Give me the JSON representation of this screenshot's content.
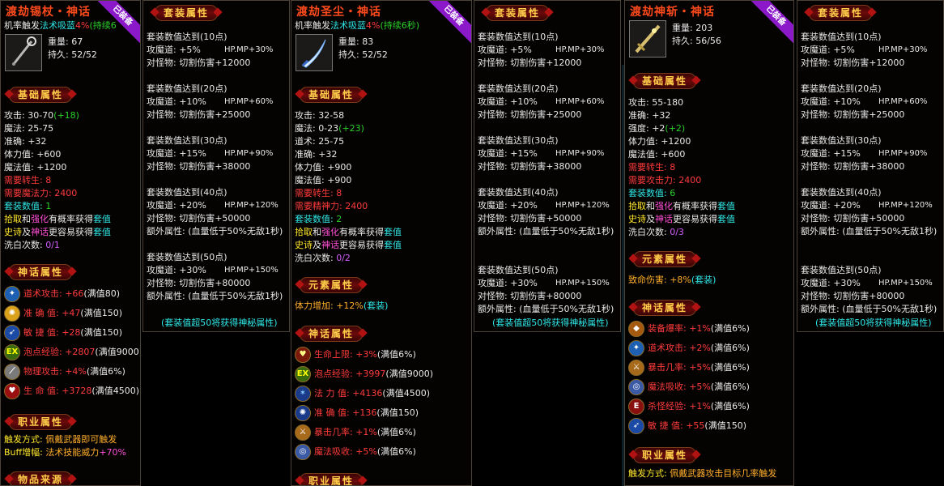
{
  "colors": {
    "title": "#ff4a1c",
    "ribbon": "#8b19c9",
    "cyan": "#2ee6e6",
    "green": "#2bd02b",
    "red": "#ff3b3b",
    "badge_text": "#ffcf4a"
  },
  "items": [
    {
      "title": "渡劫锡杖・神话",
      "equipped": "已装备",
      "trigger": "机率触发",
      "trigger_skill": "法术吸蓝",
      "trigger_pct": "4%",
      "trigger_dur": "(持续6",
      "weight_label": "重量:",
      "weight": "67",
      "dura_label": "持久:",
      "dura": "52/52",
      "icon": "staff-icon",
      "base_title": "基础属性",
      "base": [
        {
          "k": "攻击: ",
          "v": "30-70",
          "extra": "(+18)"
        },
        {
          "k": "魔法: ",
          "v": "25-75",
          "extra": ""
        },
        {
          "k": "准确: ",
          "v": "+32",
          "extra": ""
        },
        {
          "k": "体力值: ",
          "v": "+600",
          "extra": ""
        },
        {
          "k": "魔法值: ",
          "v": "+1200",
          "extra": ""
        }
      ],
      "req": [
        {
          "k": "需要转生: ",
          "v": "8"
        },
        {
          "k": "需要魔法力: ",
          "v": "2400"
        }
      ],
      "set_count_label": "套装数值: ",
      "set_count": "1",
      "tips1": [
        "拾取",
        "和",
        "强化",
        "有概率获得",
        "套值"
      ],
      "tips2": [
        "史诗",
        "及",
        "神话",
        "更容易获得",
        "套值"
      ],
      "wash_label": "洗白次数: ",
      "wash": "0/1",
      "myth_title": "神话属性",
      "myth": [
        {
          "icon": "tao-attack-icon",
          "k": "道术攻击: ",
          "v": "+66",
          "max": "(满值80)"
        },
        {
          "icon": "accuracy-icon",
          "k": "准 确 值: ",
          "v": "+47",
          "max": "(满值150)"
        },
        {
          "icon": "agility-icon",
          "k": "敏 捷 值: ",
          "v": "+28",
          "max": "(满值150)"
        },
        {
          "icon": "exp-orb-icon",
          "k": "泡点经验: ",
          "v": "+2807",
          "max": "(满值9000)"
        },
        {
          "icon": "physical-attack-icon",
          "k": "物理攻击: ",
          "v": "+4%",
          "max": "(满值6%)"
        },
        {
          "icon": "life-icon",
          "k": "生 命 值: ",
          "v": "+3728",
          "max": "(满值4500)"
        }
      ],
      "job_title": "职业属性",
      "job": [
        {
          "k": "触发方式: ",
          "v": "佩戴武器即可触发"
        },
        {
          "k": "Buff增幅: ",
          "v": "法术技能威力",
          "extra": "+70%"
        }
      ],
      "source_title": "物品来源"
    },
    {
      "title": "渡劫圣尘・神话",
      "equipped": "已装备",
      "trigger": "机率触发",
      "trigger_skill": "法术吸蓝",
      "trigger_pct": "4%",
      "trigger_dur": "(持续6秒)",
      "weight_label": "重量:",
      "weight": "83",
      "dura_label": "持久:",
      "dura": "52/52",
      "icon": "blade-icon",
      "base_title": "基础属性",
      "base": [
        {
          "k": "攻击: ",
          "v": "32-58",
          "extra": ""
        },
        {
          "k": "魔法: ",
          "v": "0-23",
          "extra": "(+23)"
        },
        {
          "k": "道术: ",
          "v": "25-75",
          "extra": ""
        },
        {
          "k": "准确: ",
          "v": "+32",
          "extra": ""
        },
        {
          "k": "体力值: ",
          "v": "+900",
          "extra": ""
        },
        {
          "k": "魔法值: ",
          "v": "+900",
          "extra": ""
        }
      ],
      "req": [
        {
          "k": "需要转生: ",
          "v": "8"
        },
        {
          "k": "需要精神力: ",
          "v": "2400"
        }
      ],
      "set_count_label": "套装数值: ",
      "set_count": "2",
      "tips1": [
        "拾取",
        "和",
        "强化",
        "有概率获得",
        "套值"
      ],
      "tips2": [
        "史诗",
        "及",
        "神话",
        "更容易获得",
        "套值"
      ],
      "wash_label": "洗白次数: ",
      "wash": "0/2",
      "element_title": "元素属性",
      "element": {
        "k": "体力增加: ",
        "v": "+12%",
        "extra": "(套装)"
      },
      "myth_title": "神话属性",
      "myth": [
        {
          "icon": "heart-icon",
          "k": "生命上限: ",
          "v": "+3%",
          "max": "(满值6%)"
        },
        {
          "icon": "exp-orb-icon",
          "k": "泡点经验: ",
          "v": "+3997",
          "max": "(满值9000)"
        },
        {
          "icon": "magic-power-icon",
          "k": "法 力 值: ",
          "v": "+4136",
          "max": "(满值4500)"
        },
        {
          "icon": "accuracy-icon",
          "k": "准 确 值: ",
          "v": "+136",
          "max": "(满值150)"
        },
        {
          "icon": "crit-icon",
          "k": "暴击几率: ",
          "v": "+1%",
          "max": "(满值6%)"
        },
        {
          "icon": "mana-drain-icon",
          "k": "魔法吸收: ",
          "v": "+5%",
          "max": "(满值6%)"
        }
      ],
      "job_title": "职业属性"
    },
    {
      "title": "渡劫神斩・神话",
      "equipped": "已装备",
      "weight_label": "重量:",
      "weight": "203",
      "dura_label": "持久:",
      "dura": "56/56",
      "icon": "sword-icon",
      "base_title": "基础属性",
      "base": [
        {
          "k": "攻击: ",
          "v": "55-180",
          "extra": ""
        },
        {
          "k": "准确: ",
          "v": "+32",
          "extra": ""
        },
        {
          "k": "强度: ",
          "v": "+2",
          "extra": "(+2)"
        },
        {
          "k": "体力值: ",
          "v": "+1200",
          "extra": ""
        },
        {
          "k": "魔法值: ",
          "v": "+600",
          "extra": ""
        }
      ],
      "req": [
        {
          "k": "需要转生: ",
          "v": "8"
        },
        {
          "k": "需要攻击力: ",
          "v": "2400"
        }
      ],
      "set_count_label": "套装数值: ",
      "set_count": "6",
      "tips1": [
        "拾取",
        "和",
        "强化",
        "有概率获得",
        "套值"
      ],
      "tips2": [
        "史诗",
        "及",
        "神话",
        "更容易获得",
        "套值"
      ],
      "wash_label": "洗白次数: ",
      "wash": "0/3",
      "element_title": "元素属性",
      "element": {
        "k": "致命伤害: ",
        "v": "+8%",
        "extra": "(套装)"
      },
      "myth_title": "神话属性",
      "myth": [
        {
          "icon": "drop-rate-icon",
          "k": "装备爆率: ",
          "v": "+1%",
          "max": "(满值6%)"
        },
        {
          "icon": "tao-attack-icon",
          "k": "道术攻击: ",
          "v": "+2%",
          "max": "(满值6%)"
        },
        {
          "icon": "crit-icon",
          "k": "暴击几率: ",
          "v": "+5%",
          "max": "(满值6%)"
        },
        {
          "icon": "mana-drain-icon",
          "k": "魔法吸收: ",
          "v": "+5%",
          "max": "(满值6%)"
        },
        {
          "icon": "kill-exp-icon",
          "k": "杀怪经验: ",
          "v": "+1%",
          "max": "(满值6%)"
        },
        {
          "icon": "agility-icon",
          "k": "敏 捷 值: ",
          "v": "+55",
          "max": "(满值150)"
        }
      ],
      "job_title": "职业属性",
      "job": [
        {
          "k": "触发方式: ",
          "v": "佩戴武器攻击目标几率触发"
        }
      ]
    }
  ],
  "set": {
    "title": "套装属性",
    "tiers": [
      {
        "head": "套装数值达到(10点)",
        "atk": "攻魔道: +5%",
        "hpmp": "HP.MP+30%",
        "cut": "对怪物: 切割伤害+12000"
      },
      {
        "head": "套装数值达到(20点)",
        "atk": "攻魔道: +10%",
        "hpmp": "HP.MP+60%",
        "cut": "对怪物: 切割伤害+25000"
      },
      {
        "head": "套装数值达到(30点)",
        "atk": "攻魔道: +15%",
        "hpmp": "HP.MP+90%",
        "cut": "对怪物: 切割伤害+38000"
      },
      {
        "head": "套装数值达到(40点)",
        "atk": "攻魔道: +20%",
        "hpmp": "HP.MP+120%",
        "cut": "对怪物: 切割伤害+50000",
        "extra": "额外属性: (血量低于50%无敌1秒)"
      },
      {
        "head": "套装数值达到(50点)",
        "atk": "攻魔道: +30%",
        "hpmp": "HP.MP+150%",
        "cut": "对怪物: 切割伤害+80000",
        "extra": "额外属性: (血量低于50%无敌1秒)"
      }
    ],
    "footer": "(套装值超50将获得神秘属性)"
  }
}
